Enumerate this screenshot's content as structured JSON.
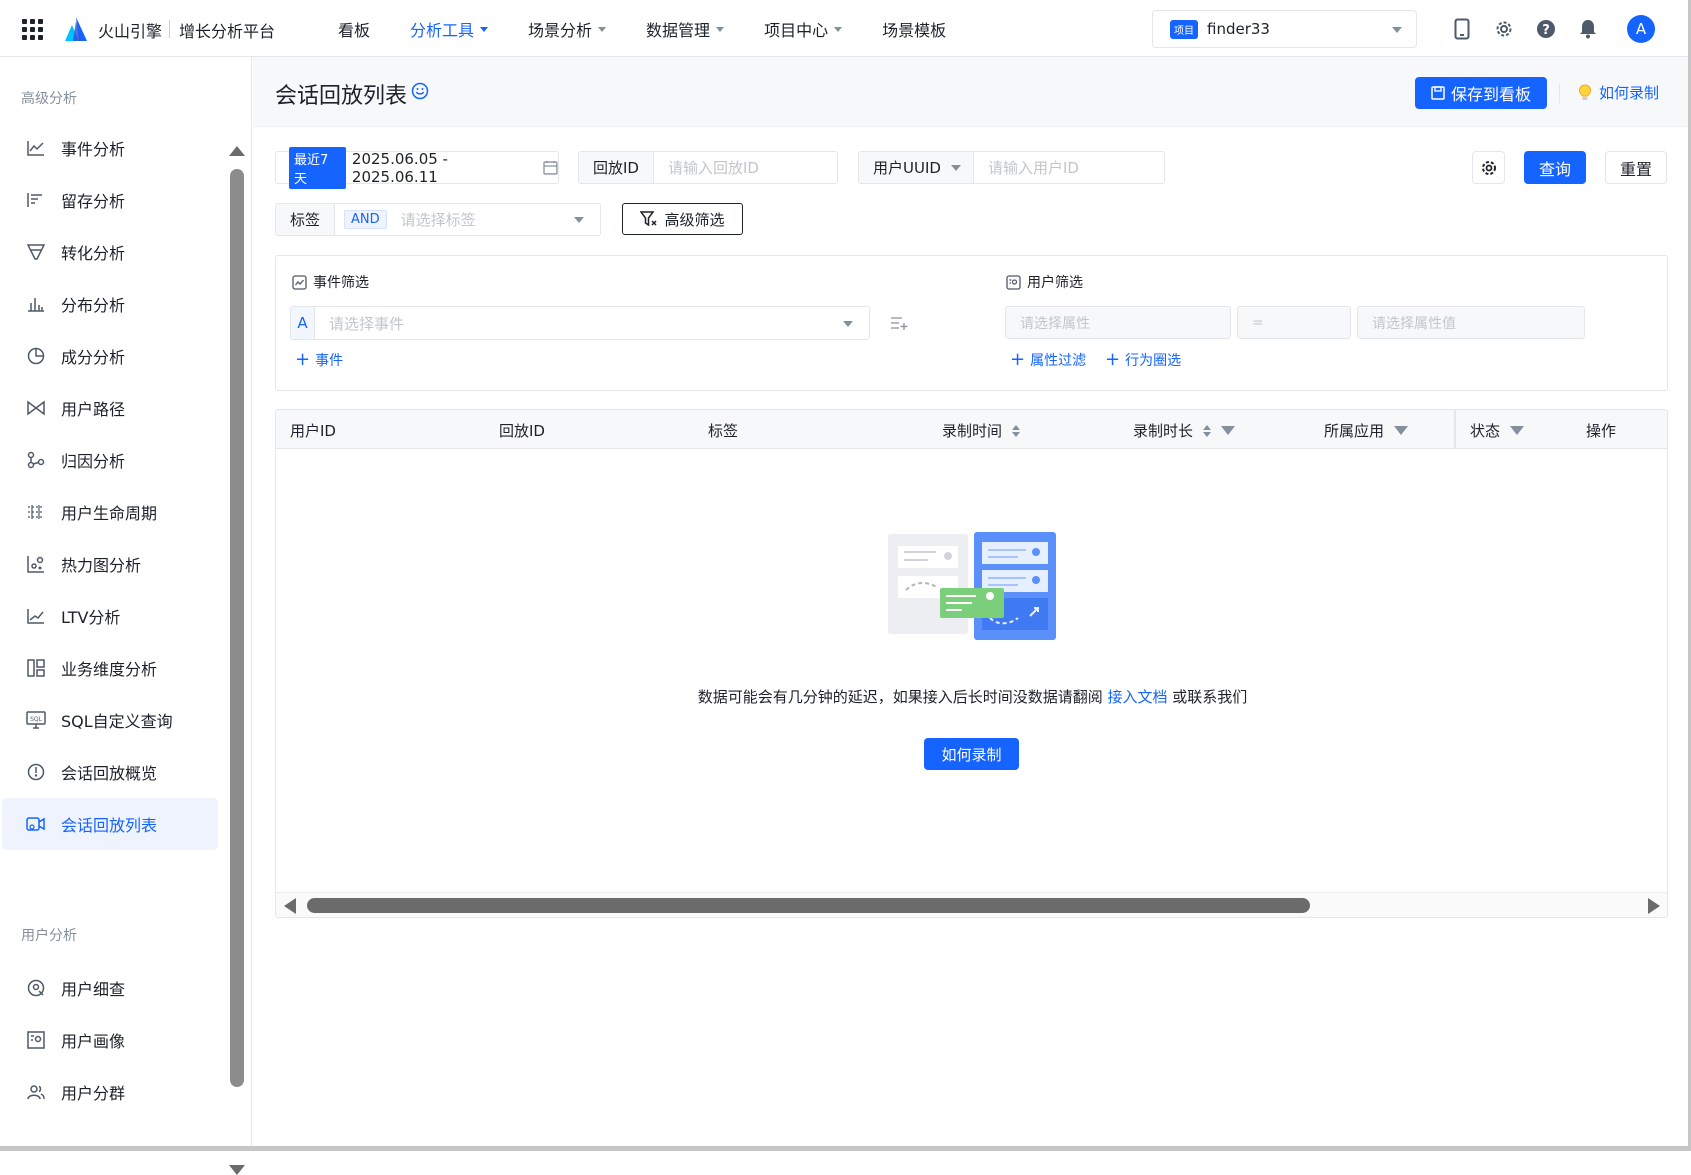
{
  "topbar": {
    "brand": "火山引擎",
    "platform": "增长分析平台",
    "nav": [
      {
        "label": "看板",
        "dropdown": false
      },
      {
        "label": "分析工具",
        "dropdown": true,
        "active": true
      },
      {
        "label": "场景分析",
        "dropdown": true
      },
      {
        "label": "数据管理",
        "dropdown": true
      },
      {
        "label": "项目中心",
        "dropdown": true
      },
      {
        "label": "场景模板",
        "dropdown": false
      }
    ],
    "project_tag": "项目",
    "project_name": "finder33",
    "avatar_letter": "A",
    "icons": [
      "mobile-icon",
      "gear-icon",
      "help-icon",
      "bell-icon"
    ]
  },
  "sidebar": {
    "groups": [
      {
        "title": "高级分析",
        "items": [
          {
            "label": "事件分析",
            "icon": "line-chart-icon"
          },
          {
            "label": "留存分析",
            "icon": "retention-icon"
          },
          {
            "label": "转化分析",
            "icon": "funnel-icon"
          },
          {
            "label": "分布分析",
            "icon": "bar-chart-icon"
          },
          {
            "label": "成分分析",
            "icon": "pie-chart-icon"
          },
          {
            "label": "用户路径",
            "icon": "path-icon"
          },
          {
            "label": "归因分析",
            "icon": "attribution-icon"
          },
          {
            "label": "用户生命周期",
            "icon": "lifecycle-icon"
          },
          {
            "label": "热力图分析",
            "icon": "heatmap-icon"
          },
          {
            "label": "LTV分析",
            "icon": "ltv-icon"
          },
          {
            "label": "业务维度分析",
            "icon": "dimension-icon"
          },
          {
            "label": "SQL自定义查询",
            "icon": "sql-icon"
          },
          {
            "label": "会话回放概览",
            "icon": "replay-overview-icon"
          },
          {
            "label": "会话回放列表",
            "icon": "replay-list-icon",
            "active": true
          }
        ]
      },
      {
        "title": "用户分析",
        "items": [
          {
            "label": "用户细查",
            "icon": "user-search-icon"
          },
          {
            "label": "用户画像",
            "icon": "user-portrait-icon"
          },
          {
            "label": "用户分群",
            "icon": "user-group-icon"
          }
        ]
      }
    ]
  },
  "header": {
    "title": "会话回放列表",
    "save_label": "保存到看板",
    "help_label": "如何录制"
  },
  "filters": {
    "date_tag": "最近7天",
    "date_range": "2025.06.05 - 2025.06.11",
    "replay_id_label": "回放ID",
    "replay_id_placeholder": "请输入回放ID",
    "uuid_label": "用户UUID",
    "uuid_placeholder": "请输入用户ID",
    "query_label": "查询",
    "reset_label": "重置",
    "tag_label": "标签",
    "tag_logic": "AND",
    "tag_placeholder": "请选择标签",
    "advanced_label": "高级筛选"
  },
  "advanced": {
    "event_title": "事件筛选",
    "event_letter": "A",
    "event_placeholder": "请选择事件",
    "add_event": "事件",
    "user_title": "用户筛选",
    "attr_placeholder": "请选择属性",
    "operator": "=",
    "value_placeholder": "请选择属性值",
    "add_attr_filter": "属性过滤",
    "add_behavior_filter": "行为圈选"
  },
  "table": {
    "columns": [
      "用户ID",
      "回放ID",
      "标签",
      "录制时间",
      "录制时长",
      "所属应用",
      "状态",
      "操作"
    ],
    "rows": [],
    "empty_text": "数据可能会有几分钟的延迟，如果接入后长时间没数据请翻阅",
    "empty_link": "接入文档",
    "empty_suffix": "或联系我们",
    "empty_button": "如何录制"
  },
  "colors": {
    "accent": "#1664ff",
    "text": "#1d2129",
    "muted": "#86909c"
  }
}
